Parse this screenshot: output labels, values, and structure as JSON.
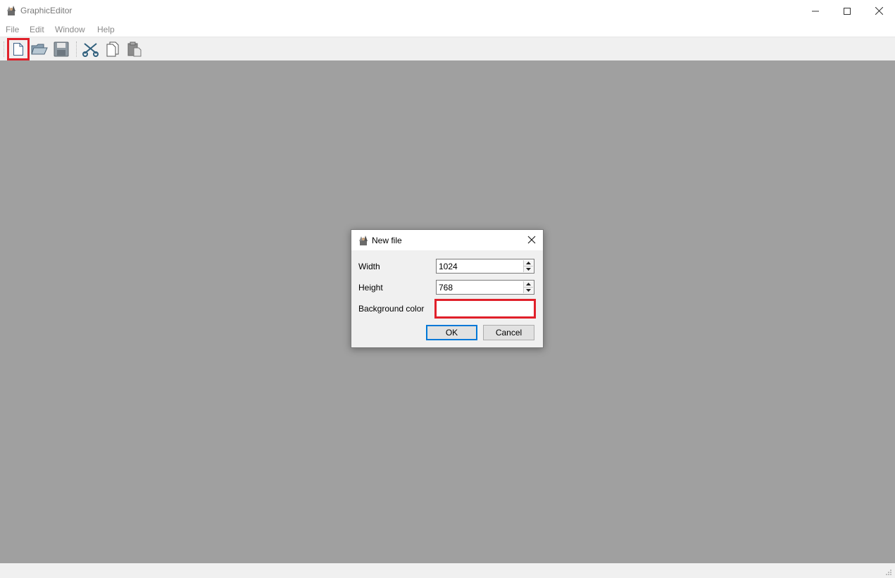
{
  "window": {
    "title": "GraphicEditor"
  },
  "menu": {
    "items": [
      "File",
      "Edit",
      "Window",
      "Help"
    ]
  },
  "toolbar": {
    "buttons": [
      {
        "name": "new-file",
        "icon": "new-file-icon",
        "highlighted": true
      },
      {
        "name": "open-file",
        "icon": "open-folder-icon"
      },
      {
        "name": "save-file",
        "icon": "floppy-disk-icon"
      },
      {
        "name": "cut",
        "icon": "scissors-icon"
      },
      {
        "name": "copy",
        "icon": "copy-icon"
      },
      {
        "name": "paste",
        "icon": "paste-icon"
      }
    ]
  },
  "dialog": {
    "title": "New file",
    "fields": {
      "width_label": "Width",
      "width_value": "1024",
      "height_label": "Height",
      "height_value": "768",
      "bg_label": "Background color",
      "bg_value": ""
    },
    "ok_label": "OK",
    "cancel_label": "Cancel"
  },
  "colors": {
    "highlight": "#e0202a",
    "workspace": "#a0a0a0",
    "accent": "#0078d7"
  }
}
